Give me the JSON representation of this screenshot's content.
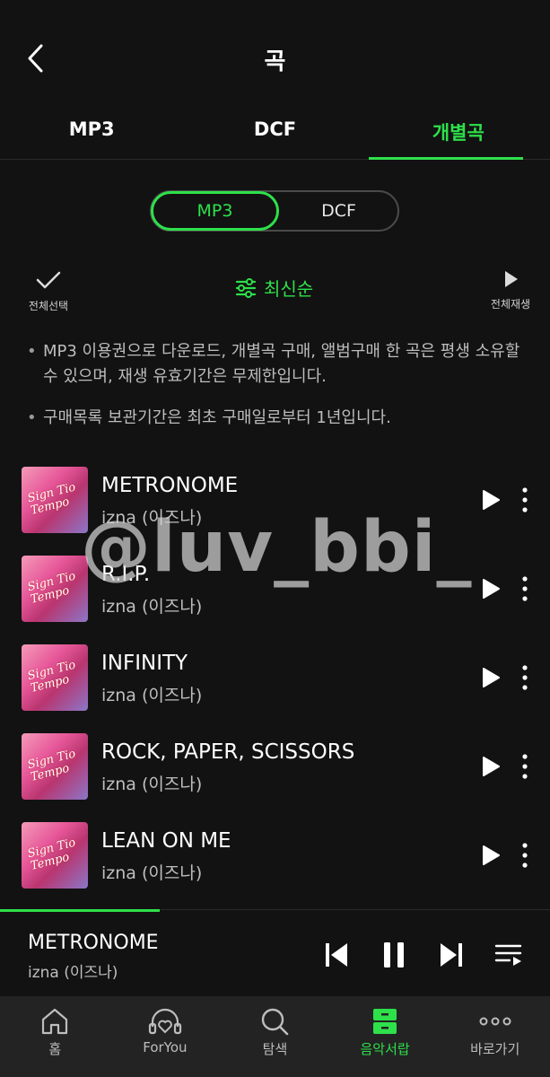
{
  "header": {
    "title": "곡"
  },
  "tabs": [
    {
      "label": "MP3"
    },
    {
      "label": "DCF"
    },
    {
      "label": "개별곡"
    }
  ],
  "segment": {
    "on_label": "MP3",
    "off_label": "DCF"
  },
  "toolbar": {
    "select_all": "전체선택",
    "sort_label": "최신순",
    "play_all": "전체재생"
  },
  "notes": [
    "MP3 이용권으로 다운로드, 개별곡 구매, 앨범구매 한 곡은 평생 소유할 수 있으며, 재생 유효기간은 무제한입니다.",
    "구매목록 보관기간은 최초 구매일로부터 1년입니다."
  ],
  "watermark": "@luv_bbi_",
  "songs": [
    {
      "title": "METRONOME",
      "artist": "izna (이즈나)"
    },
    {
      "title": "R.I.P.",
      "artist": "izna (이즈나)"
    },
    {
      "title": "INFINITY",
      "artist": "izna (이즈나)"
    },
    {
      "title": "ROCK, PAPER, SCISSORS",
      "artist": "izna (이즈나)"
    },
    {
      "title": "LEAN ON ME",
      "artist": "izna (이즈나)"
    }
  ],
  "album_cover_text": "Sign Tio Tempo",
  "now_playing": {
    "title": "METRONOME",
    "artist": "izna (이즈나)",
    "progress": 0.29
  },
  "bottom_nav": [
    {
      "label": "홈",
      "icon": "home-icon"
    },
    {
      "label": "ForYou",
      "icon": "headphones-heart-icon"
    },
    {
      "label": "탐색",
      "icon": "search-icon"
    },
    {
      "label": "음악서랍",
      "icon": "drawer-icon"
    },
    {
      "label": "바로가기",
      "icon": "more-dots-icon"
    }
  ],
  "colors": {
    "accent": "#2ee04a",
    "background": "#121212",
    "nav_background": "#232323"
  }
}
